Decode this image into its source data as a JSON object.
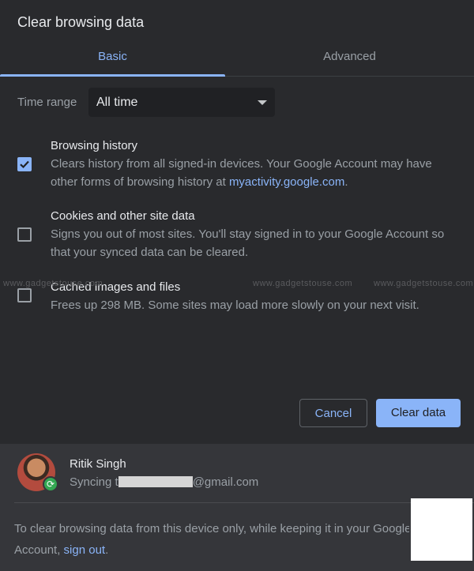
{
  "dialog": {
    "title": "Clear browsing data"
  },
  "tabs": [
    {
      "label": "Basic",
      "selected": true
    },
    {
      "label": "Advanced",
      "selected": false
    }
  ],
  "time_range": {
    "label": "Time range",
    "value": "All time"
  },
  "options": {
    "browsing_history": {
      "title": "Browsing history",
      "desc_before": "Clears history from all signed-in devices. Your Google Account may have other forms of browsing history at ",
      "link": "myactivity.google.com",
      "desc_after": ".",
      "checked": true
    },
    "cookies": {
      "title": "Cookies and other site data",
      "desc": "Signs you out of most sites. You'll stay signed in to your Google Account so that your synced data can be cleared.",
      "checked": false
    },
    "cache": {
      "title": "Cached images and files",
      "desc": "Frees up 298 MB. Some sites may load more slowly on your next visit.",
      "checked": false
    }
  },
  "buttons": {
    "cancel": "Cancel",
    "clear": "Clear data"
  },
  "account": {
    "name": "Ritik Singh",
    "sync_prefix": "Syncing t",
    "sync_suffix": "@gmail.com"
  },
  "footer": {
    "note": "To clear browsing data from this device only, while keeping it in your Google",
    "note_line2_prefix": "Account, ",
    "sign_out": "sign out",
    "note_line2_suffix": "."
  },
  "watermark": "www.gadgetstouse.com",
  "colors": {
    "accent": "#8ab4f8",
    "background": "#292a2d",
    "footer": "#35363a"
  }
}
